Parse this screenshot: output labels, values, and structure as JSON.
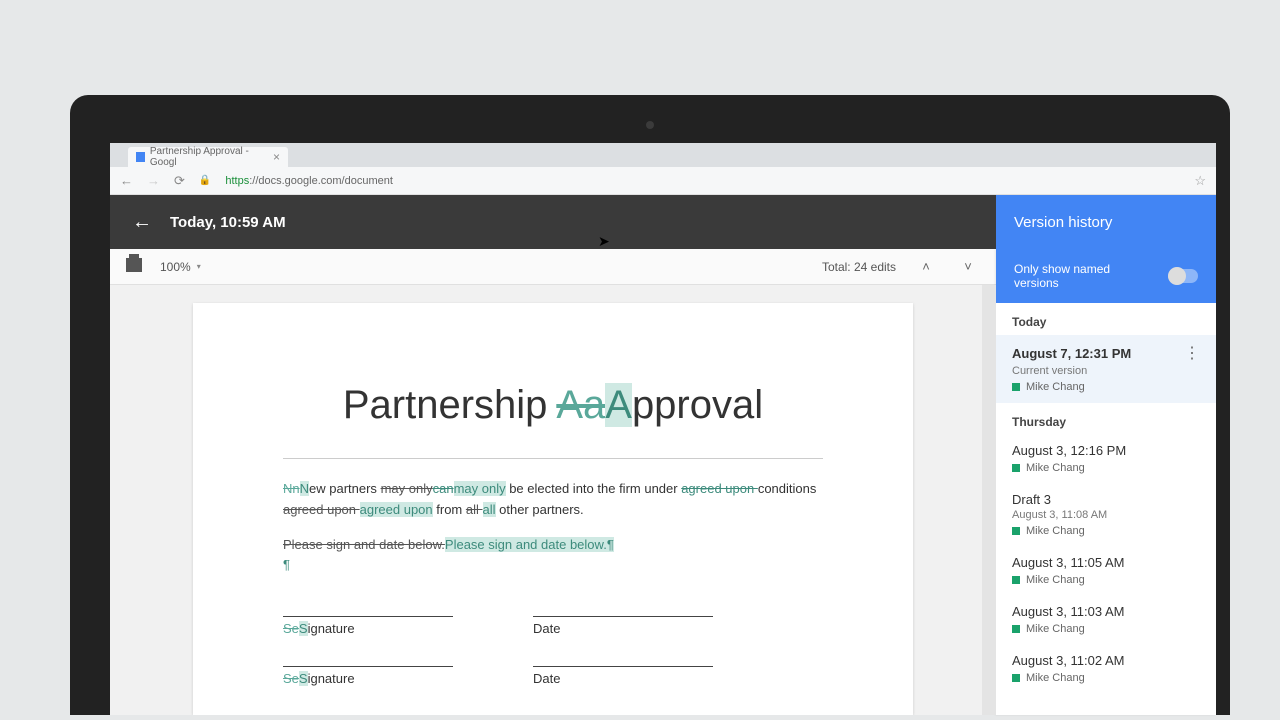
{
  "browser": {
    "tab_title": "Partnership Approval - Googl",
    "url_https": "https",
    "url_rest": "://docs.google.com/document"
  },
  "header": {
    "title": "Today, 10:59 AM"
  },
  "toolbar": {
    "zoom": "100%",
    "total_edits": "Total: 24 edits"
  },
  "doc": {
    "title_pre": "Partnership ",
    "title_strike": "Aa",
    "title_ins": "A",
    "title_post": "pproval",
    "p1_a": "Nn",
    "p1_b": "N",
    "p1_c": "ew partners ",
    "p1_d": "may only",
    "p1_e": "can",
    "p1_f": "may only",
    "p1_g": " be elected into the firm under ",
    "p1_h": "agreed upon ",
    "p1_i": "conditions ",
    "p1_j": "agreed upon ",
    "p1_k": "agreed upon",
    "p1_l": " from ",
    "p1_m": "all ",
    "p1_n": "all",
    "p1_o": " other partners.",
    "p2_a": "Please sign and date below.",
    "p2_b": "Please sign and date below.",
    "pilcrow": "¶",
    "sig": "Signature",
    "sig_s1": "Se",
    "sig_s2": "S",
    "date": "Date"
  },
  "sidebar": {
    "heading": "Version history",
    "filter": "Only show named versions",
    "sections": [
      "Today",
      "Thursday"
    ],
    "color": "#1aa26b",
    "versions": [
      {
        "time": "August 7, 12:31 PM",
        "sub": "Current version",
        "user": "Mike Chang",
        "active": true
      },
      {
        "time": "August 3, 12:16 PM",
        "user": "Mike Chang"
      },
      {
        "time": "Draft 3",
        "sub": "August 3, 11:08 AM",
        "user": "Mike Chang"
      },
      {
        "time": "August 3, 11:05 AM",
        "user": "Mike Chang"
      },
      {
        "time": "August 3, 11:03 AM",
        "user": "Mike Chang"
      },
      {
        "time": "August 3, 11:02 AM",
        "user": "Mike Chang"
      }
    ]
  }
}
